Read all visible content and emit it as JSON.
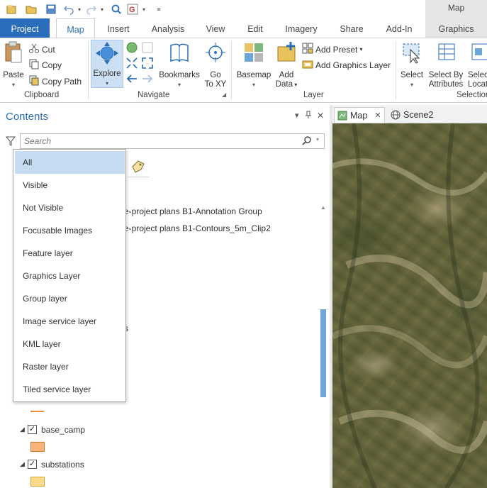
{
  "context_tab_group": "Map",
  "tabs": [
    "Project",
    "Map",
    "Insert",
    "Analysis",
    "View",
    "Edit",
    "Imagery",
    "Share",
    "Add-In",
    "Graphics"
  ],
  "ribbon": {
    "clipboard": {
      "paste": "Paste",
      "cut": "Cut",
      "copy": "Copy",
      "copy_path": "Copy Path",
      "label": "Clipboard"
    },
    "navigate": {
      "explore": "Explore",
      "bookmarks": "Bookmarks",
      "go_to_xy_1": "Go",
      "go_to_xy_2": "To XY",
      "label": "Navigate"
    },
    "layer": {
      "basemap": "Basemap",
      "add_data_1": "Add",
      "add_data_2": "Data",
      "add_preset": "Add Preset",
      "add_graphics_layer": "Add Graphics Layer",
      "label": "Layer"
    },
    "selection": {
      "select": "Select",
      "select_by_attr_1": "Select By",
      "select_by_attr_2": "Attributes",
      "select_by_loc_1": "Selec",
      "select_by_loc_2": "Locat",
      "label": "Selection"
    }
  },
  "contents": {
    "title": "Contents",
    "search_placeholder": "Search",
    "filter_options": [
      "All",
      "Visible",
      "Not Visible",
      "Focusable Images",
      "Feature layer",
      "Graphics Layer",
      "Group layer",
      "Image service layer",
      "KML layer",
      "Raster layer",
      "Tiled service layer"
    ],
    "partial_layers": [
      "e-project plans B1-Annotation Group",
      "e-project plans B1-Contours_5m_Clip2"
    ],
    "layers": [
      {
        "name": "base_camp",
        "checked": true,
        "swatch": "#f9b47a"
      },
      {
        "name": "substations",
        "checked": true,
        "swatch": "#fbd98a"
      }
    ]
  },
  "map_tabs": [
    {
      "label": "Map"
    },
    {
      "label": "Scene2"
    }
  ]
}
